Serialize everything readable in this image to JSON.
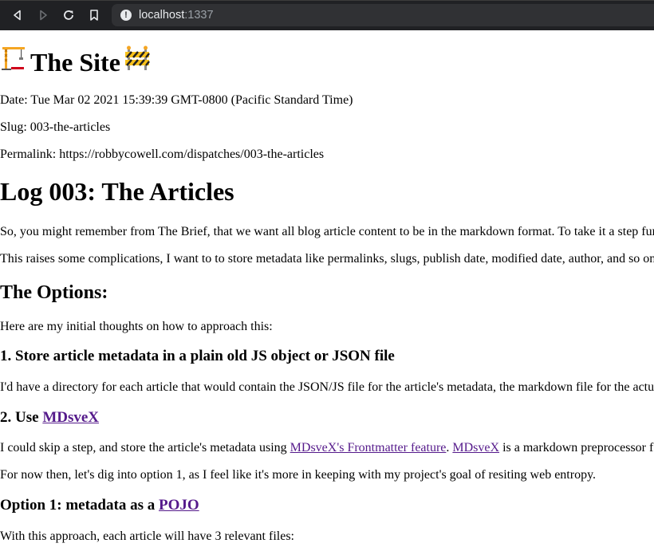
{
  "browser": {
    "url_host": "localhost",
    "url_port": ":1337"
  },
  "page": {
    "site_title": "The Site",
    "date_line": "Date: Tue Mar 02 2021 15:39:39 GMT-0800 (Pacific Standard Time)",
    "slug_line": "Slug: 003-the-articles",
    "permalink_line": "Permalink: https://robbycowell.com/dispatches/003-the-articles",
    "article_title": "Log 003: The Articles",
    "para1": "So, you might remember from The Brief, that we want all blog article content to be in the markdown format. To take it a step fur",
    "para2": "This raises some complications, I want to to store metadata like permalinks, slugs, publish date, modified date, author, and so on",
    "options_heading": "The Options:",
    "options_intro": "Here are my initial thoughts on how to approach this:",
    "option1_heading": "1. Store article metadata in a plain old JS object or JSON file",
    "option1_text": "I'd have a directory for each article that would contain the JSON/JS file for the article's metadata, the markdown file for the actua",
    "option2_heading_prefix": "2. Use ",
    "option2_link": "MDsveX",
    "option2_text_prefix": "I could skip a step, and store the article's metadata using ",
    "option2_link_frontmatter": "MDsveX's Frontmatter feature",
    "option2_text_mid": ". ",
    "option2_link_mdsvex": "MDsveX",
    "option2_text_suffix": " is a markdown preprocessor f",
    "decision_text": "For now then, let's dig into option 1, as I feel like it's more in keeping with my project's goal of resiting web entropy.",
    "option1_detail_prefix": "Option 1: metadata as a ",
    "option1_detail_link": "POJO",
    "approach_text": "With this approach, each article will have 3 relevant files:"
  }
}
